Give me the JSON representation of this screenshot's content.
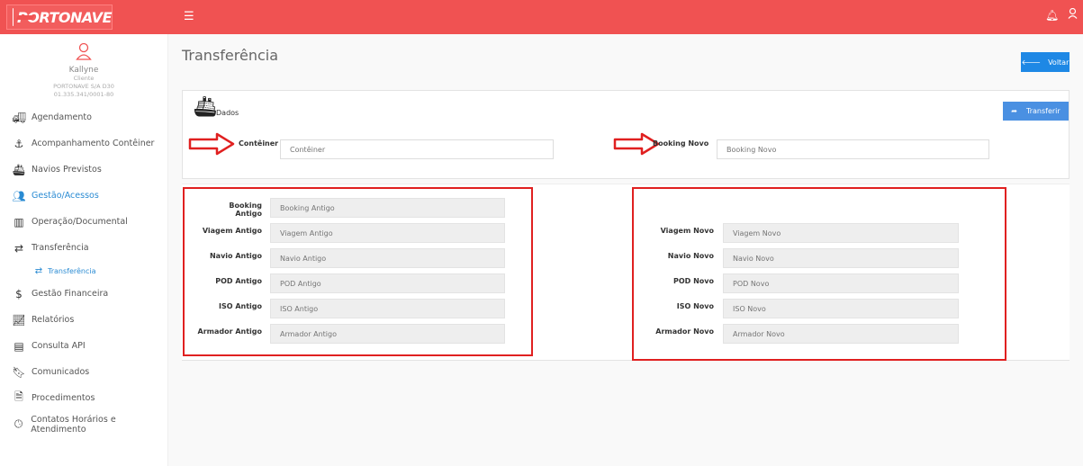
{
  "app": {
    "logo_text": "PORTONAVE",
    "menu_icon": "hamburger-icon",
    "accent": "#f05252",
    "link_color": "#2a8bd3"
  },
  "header": {
    "icons": [
      "bell-icon",
      "user-icon"
    ]
  },
  "profile": {
    "name": "Kallyne",
    "role": "Cliente",
    "company": "PORTONAVE S/A D30",
    "doc": "01.335.341/0001-80"
  },
  "sidebar": {
    "items": [
      {
        "label": "Agendamento",
        "icon": "truck-icon"
      },
      {
        "label": "Acompanhamento Contêiner",
        "icon": "anchor-icon"
      },
      {
        "label": "Navios Previstos",
        "icon": "ship-icon"
      },
      {
        "label": "Gestão/Acessos",
        "icon": "users-icon"
      },
      {
        "label": "Operação/Documental",
        "icon": "bar-chart-icon"
      },
      {
        "label": "Transferência",
        "icon": "exchange-icon"
      },
      {
        "label": "Transferência",
        "icon": "exchange-icon"
      },
      {
        "label": "Gestão Financeira",
        "icon": "dollar-icon"
      },
      {
        "label": "Relatórios",
        "icon": "line-chart-icon"
      },
      {
        "label": "Consulta API",
        "icon": "list-icon"
      },
      {
        "label": "Comunicados",
        "icon": "bookmark-icon"
      },
      {
        "label": "Procedimentos",
        "icon": "document-icon"
      },
      {
        "label": "Contatos Horários e Atendimento",
        "icon": "clock-icon"
      }
    ]
  },
  "page": {
    "title": "Transferência",
    "back_label": "Voltar"
  },
  "panel": {
    "title": "Dados",
    "transfer_label": "Transferir",
    "container_label": "Contêiner",
    "container_placeholder": "Contêiner",
    "booking_new_label": "Booking Novo",
    "booking_new_placeholder": "Booking Novo"
  },
  "old": {
    "fields": [
      {
        "label": "Booking Antigo",
        "placeholder": "Booking Antigo"
      },
      {
        "label": "Viagem Antigo",
        "placeholder": "Viagem Antigo"
      },
      {
        "label": "Navio Antigo",
        "placeholder": "Navio Antigo"
      },
      {
        "label": "POD Antigo",
        "placeholder": "POD Antigo"
      },
      {
        "label": "ISO Antigo",
        "placeholder": "ISO Antigo"
      },
      {
        "label": "Armador Antigo",
        "placeholder": "Armador Antigo"
      }
    ]
  },
  "new": {
    "fields": [
      {
        "label": "Viagem Novo",
        "placeholder": "Viagem Novo"
      },
      {
        "label": "Navio Novo",
        "placeholder": "Navio Novo"
      },
      {
        "label": "POD Novo",
        "placeholder": "POD Novo"
      },
      {
        "label": "ISO Novo",
        "placeholder": "ISO Novo"
      },
      {
        "label": "Armador Novo",
        "placeholder": "Armador Novo"
      }
    ]
  },
  "annotation_color": "#e02020"
}
